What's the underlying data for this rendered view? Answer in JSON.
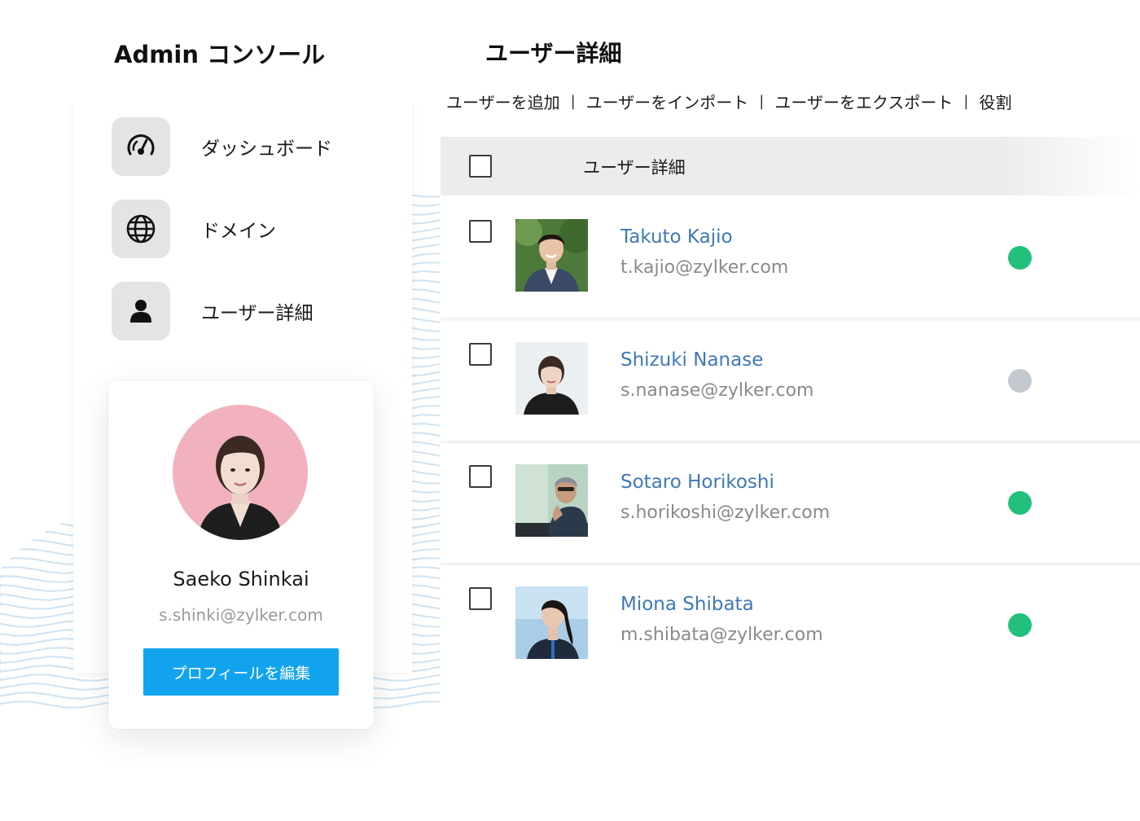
{
  "sidebar": {
    "title": "Admin コンソール",
    "items": [
      {
        "label": "ダッシュボード",
        "icon": "dashboard-gauge-icon"
      },
      {
        "label": "ドメイン",
        "icon": "globe-icon"
      },
      {
        "label": "ユーザー詳細",
        "icon": "user-icon"
      }
    ]
  },
  "profile": {
    "name": "Saeko Shinkai",
    "email": "s.shinki@zylker.com",
    "edit_label": "プロフィールを編集"
  },
  "main": {
    "title": "ユーザー詳細",
    "toolbar": [
      "ユーザーを追加",
      "ユーザーをインポート",
      "ユーザーをエクスポート",
      "役割"
    ],
    "table_header": "ユーザー詳細",
    "users": [
      {
        "name": "Takuto Kajio",
        "email": "t.kajio@zylker.com",
        "status_color": "#22c07a"
      },
      {
        "name": "Shizuki Nanase",
        "email": "s.nanase@zylker.com",
        "status_color": "#c4c9cf"
      },
      {
        "name": "Sotaro Horikoshi",
        "email": "s.horikoshi@zylker.com",
        "status_color": "#22c07a"
      },
      {
        "name": "Miona Shibata",
        "email": "m.shibata@zylker.com",
        "status_color": "#22c07a"
      }
    ]
  },
  "colors": {
    "accent": "#12a3ef",
    "link": "#3f78b6",
    "online": "#22c07a",
    "offline": "#c4c9cf"
  }
}
